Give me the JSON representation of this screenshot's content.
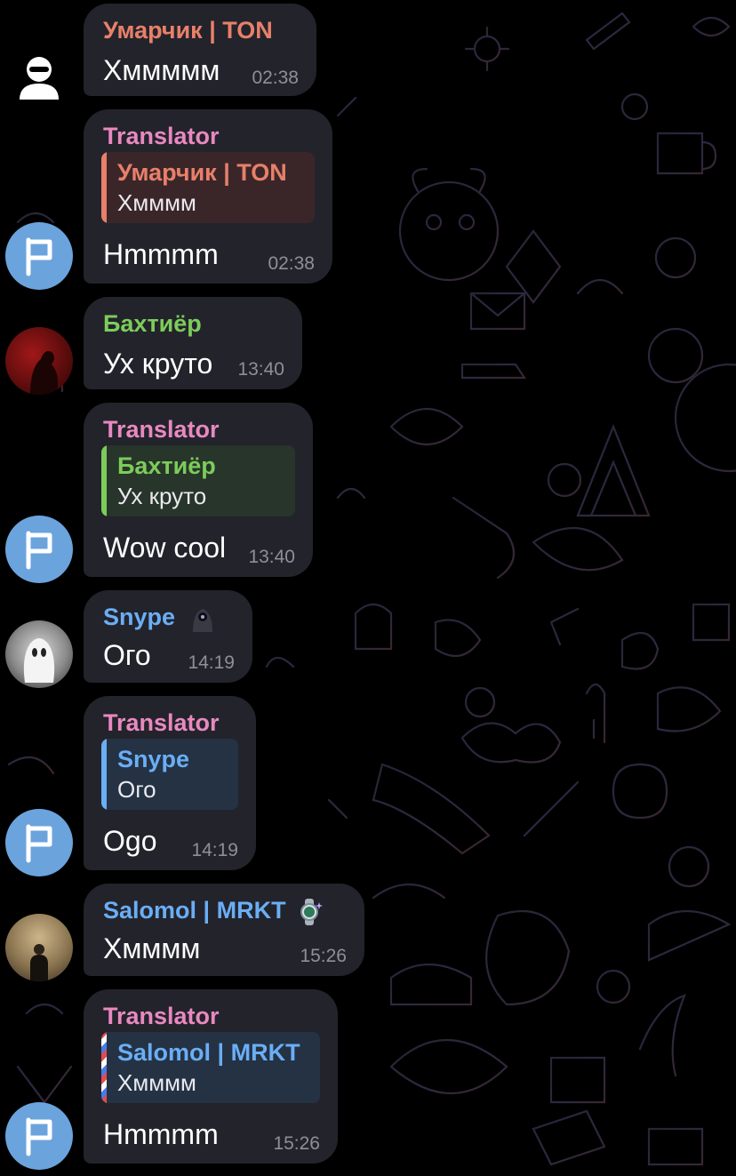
{
  "chat": {
    "messages": [
      {
        "sender": "Умарчик | TON",
        "text": "Хммммм",
        "time": "02:38"
      },
      {
        "sender": "Translator",
        "reply_to": {
          "name": "Умарчик | TON",
          "text": "Хмммм"
        },
        "text": "Hmmmm",
        "time": "02:38"
      },
      {
        "sender": "Бахтиёр",
        "text": "Ух круто",
        "time": "13:40"
      },
      {
        "sender": "Translator",
        "reply_to": {
          "name": "Бахтиёр",
          "text": "Ух круто"
        },
        "text": "Wow cool",
        "time": "13:40"
      },
      {
        "sender": "Snype",
        "text": "Ого",
        "time": "14:19"
      },
      {
        "sender": "Translator",
        "reply_to": {
          "name": "Snype",
          "text": "Ого"
        },
        "text": "Ogo",
        "time": "14:19"
      },
      {
        "sender": "Salomol | MRKT",
        "text": "Хмммм",
        "time": "15:26"
      },
      {
        "sender": "Translator",
        "reply_to": {
          "name": "Salomol | MRKT",
          "text": "Хмммм"
        },
        "text": "Hmmmm",
        "time": "15:26"
      }
    ]
  },
  "colors": {
    "background": "#000000",
    "bubble": "#23232b",
    "name_umarchik": "#e8806a",
    "name_translator": "#e889c0",
    "name_bakhtiyor": "#7ccc5a",
    "name_snype": "#6aaef5",
    "name_salomol": "#6aaef5",
    "translator_avatar": "#6ba3dd",
    "time": "#8f8f98"
  },
  "icons": {
    "translator_avatar": "flag-icon",
    "umarchik_avatar": "anonymous-user-icon",
    "snype_status": "hooded-figure-icon",
    "salomol_status": "watch-icon"
  }
}
